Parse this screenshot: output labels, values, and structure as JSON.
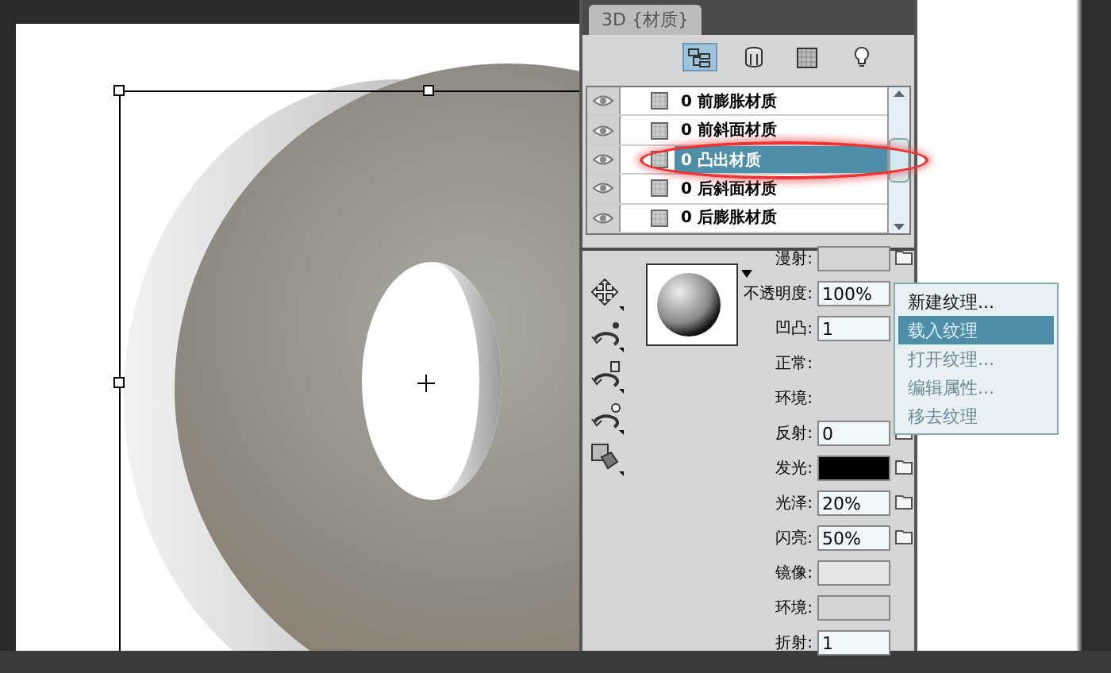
{
  "panel": {
    "title": "3D {材质}",
    "view_tabs": [
      {
        "kind": "scene",
        "selected": true
      },
      {
        "kind": "mesh",
        "selected": false
      },
      {
        "kind": "material",
        "selected": false
      },
      {
        "kind": "light",
        "selected": false
      }
    ],
    "materials": [
      {
        "label": "0 前膨胀材质",
        "selected": false
      },
      {
        "label": "0 前斜面材质",
        "selected": false
      },
      {
        "label": "0 凸出材质",
        "selected": true
      },
      {
        "label": "0 后斜面材质",
        "selected": false
      },
      {
        "label": "0 后膨胀材质",
        "selected": false
      }
    ],
    "properties": [
      {
        "label": "漫射:",
        "kind": "swatch",
        "color": "#d4d4d4",
        "folder": true
      },
      {
        "label": "不透明度:",
        "kind": "text",
        "value": "100%",
        "folder": false
      },
      {
        "label": "凹凸:",
        "kind": "text",
        "value": "1",
        "folder": false
      },
      {
        "label": "正常:",
        "kind": "none",
        "folder": false
      },
      {
        "label": "环境:",
        "kind": "none",
        "folder": false
      },
      {
        "label": "反射:",
        "kind": "text",
        "value": "0",
        "folder": true
      },
      {
        "label": "发光:",
        "kind": "swatch",
        "color": "#000000",
        "folder": true
      },
      {
        "label": "光泽:",
        "kind": "text",
        "value": "20%",
        "folder": true
      },
      {
        "label": "闪亮:",
        "kind": "text",
        "value": "50%",
        "folder": true
      },
      {
        "label": "镜像:",
        "kind": "swatch",
        "color": "#e6e6e6",
        "folder": false
      },
      {
        "label": "环境:",
        "kind": "swatch",
        "color": "#d4d4d4",
        "folder": false
      },
      {
        "label": "折射:",
        "kind": "text",
        "value": "1",
        "folder": false
      }
    ],
    "texture_menu": [
      {
        "label": "新建纹理...",
        "selected": false
      },
      {
        "label": "载入纹理",
        "selected": true
      },
      {
        "label": "打开纹理...",
        "selected": false
      },
      {
        "label": "编辑属性...",
        "selected": false
      },
      {
        "label": "移去纹理",
        "selected": false
      }
    ]
  }
}
